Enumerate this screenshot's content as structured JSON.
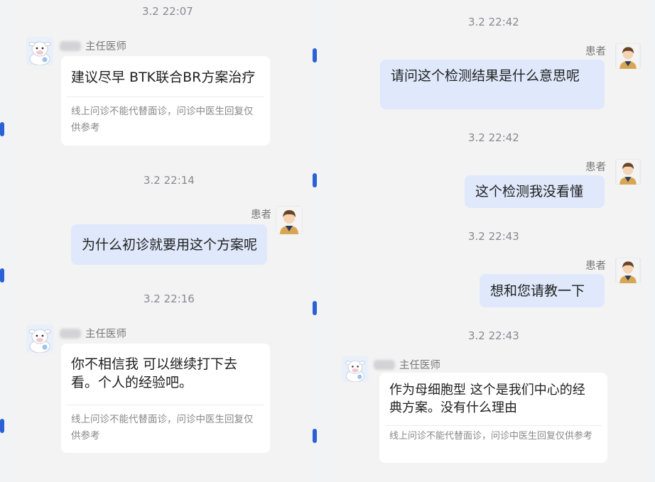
{
  "left": {
    "time_top": "3.2 22:07",
    "doctor_title": "主任医师",
    "doc_msg1": "建议尽早 BTK联合BR方案治疗",
    "disclaimer": "线上问诊不能代替面诊，问诊中医生回复仅供参考",
    "time2": "3.2 22:14",
    "patient_label": "患者",
    "pat_msg1": "为什么初诊就要用这个方案呢",
    "time3": "3.2 22:16",
    "doc_msg2": "你不相信我 可以继续打下去看。个人的经验吧。"
  },
  "right": {
    "time1": "3.2 22:42",
    "patient_label": "患者",
    "pat_msg1": "请问这个检测结果是什么意思呢",
    "time2": "3.2 22:42",
    "pat_msg2": "这个检测我没看懂",
    "time3": "3.2 22:43",
    "pat_msg3": "想和您请教一下",
    "time4": "3.2 22:43",
    "doctor_title": "主任医师",
    "doc_msg": "作为母细胞型 这个是我们中心的经典方案。没有什么理由",
    "disclaimer": "线上问诊不能代替面诊，问诊中医生回复仅供参考"
  },
  "icons": {
    "doctor_avatar": "cow-cartoon-avatar",
    "patient_avatar": "person-avatar"
  },
  "colors": {
    "patient_bubble": "#dfe9fb",
    "doctor_bubble": "#ffffff",
    "accent": "#2a61d6"
  }
}
